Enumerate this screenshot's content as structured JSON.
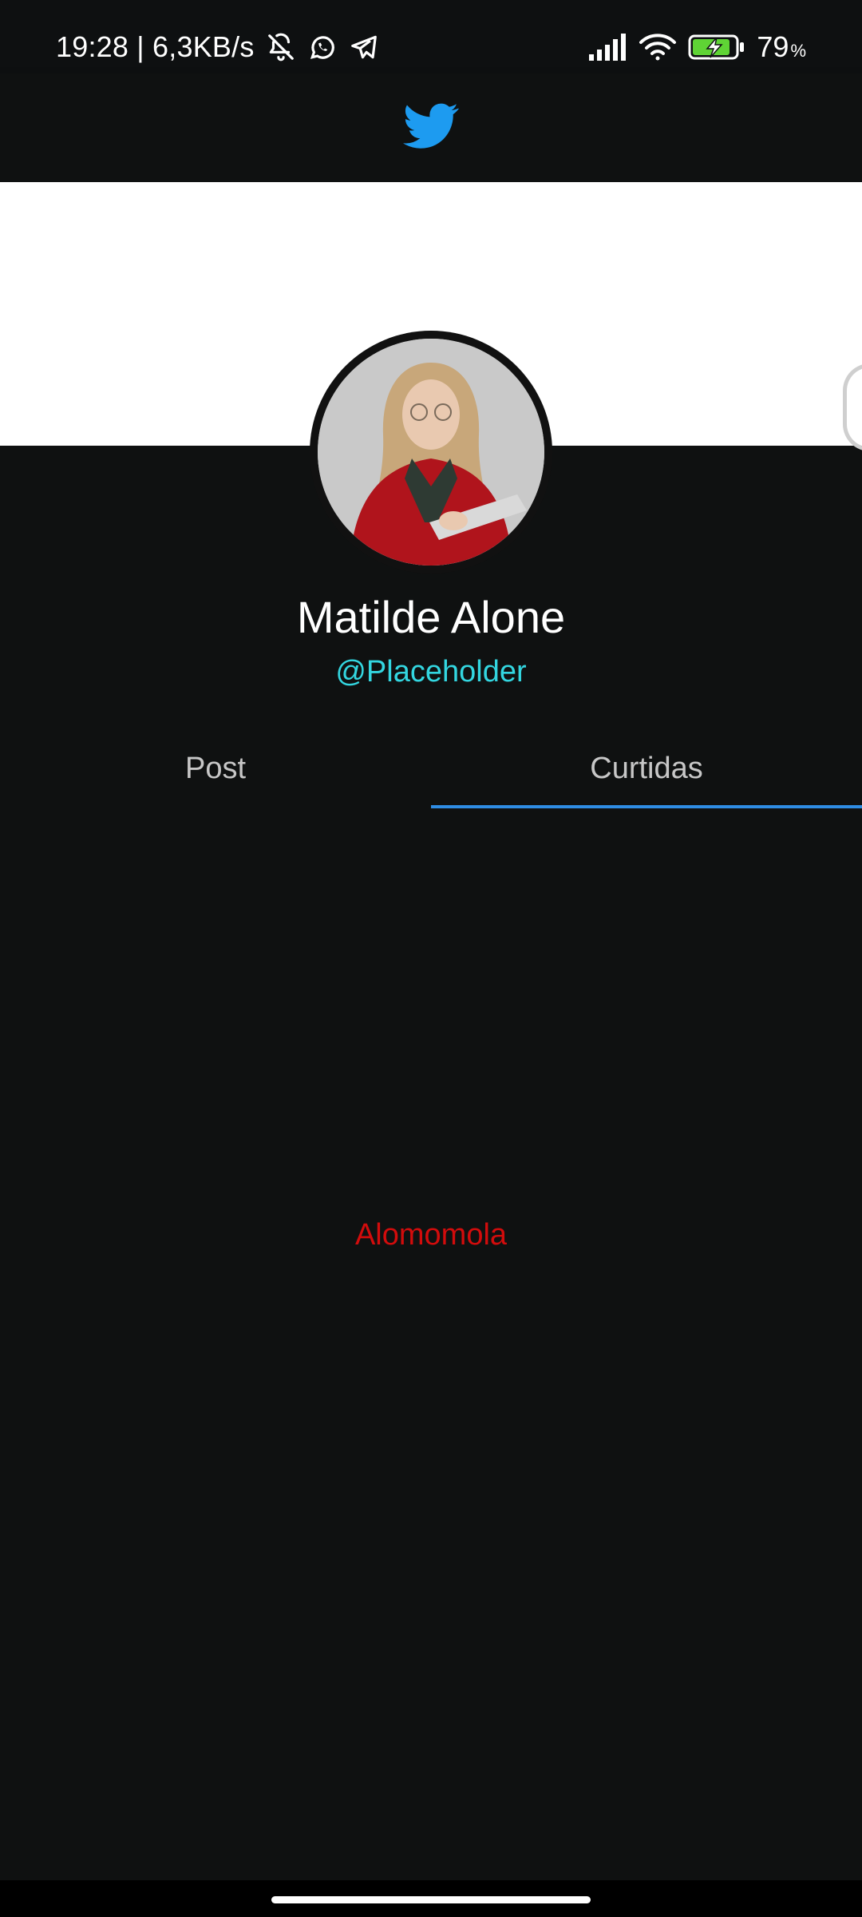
{
  "status_bar": {
    "time_speed": "19:28 | 6,3KB/s",
    "battery_percent": "79",
    "battery_unit": "%",
    "icons": [
      "bell-off-icon",
      "whatsapp-icon",
      "telegram-icon",
      "signal-icon",
      "wifi-icon",
      "battery-charging-icon"
    ]
  },
  "app_bar": {
    "logo": "twitter-bird-icon",
    "brand_color": "#1d9bf0"
  },
  "profile": {
    "name": "Matilde Alone",
    "handle": "@Placeholder",
    "handle_color": "#33d6e0"
  },
  "tabs": [
    {
      "label": "Post",
      "active": false
    },
    {
      "label": "Curtidas",
      "active": true
    }
  ],
  "tab_indicator_color": "#2f8de4",
  "content": {
    "empty_text": "Alomomola",
    "empty_text_color": "#d20c0c"
  }
}
